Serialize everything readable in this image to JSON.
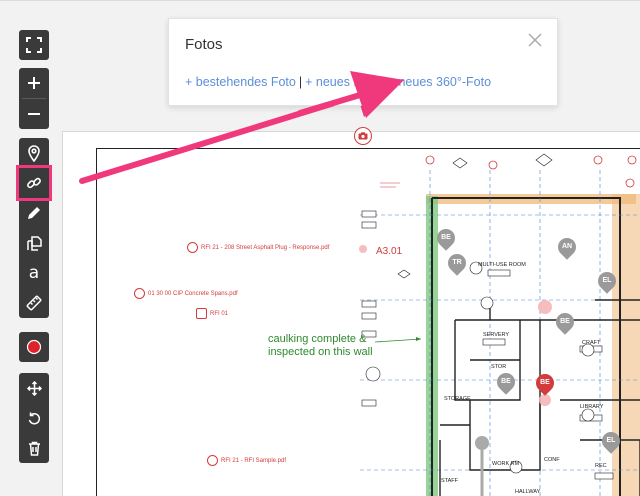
{
  "toolbar": {
    "buttons": [
      {
        "name": "fullscreen",
        "icon": "fullscreen-icon"
      },
      {
        "name": "zoom-in",
        "icon": "plus-icon"
      },
      {
        "name": "zoom-out",
        "icon": "minus-icon"
      },
      {
        "name": "pin",
        "icon": "map-pin-icon"
      },
      {
        "name": "link",
        "icon": "link-icon",
        "highlighted": true
      },
      {
        "name": "pen",
        "icon": "pen-icon"
      },
      {
        "name": "copy",
        "icon": "copy-icon"
      },
      {
        "name": "text",
        "icon": "text-icon",
        "label": "a"
      },
      {
        "name": "measure",
        "icon": "ruler-icon"
      },
      {
        "name": "record",
        "icon": "record-icon"
      },
      {
        "name": "move",
        "icon": "move-icon"
      },
      {
        "name": "undo",
        "icon": "undo-icon"
      },
      {
        "name": "delete",
        "icon": "trash-icon"
      }
    ],
    "highlight_color": "#f0387c",
    "background_color": "#3a3a3a"
  },
  "popup": {
    "title": "Fotos",
    "links": [
      {
        "label": "+ bestehendes Foto"
      },
      {
        "label": "+ neues Foto"
      },
      {
        "label": "+ neues 360°-Foto"
      }
    ],
    "separator": "|",
    "link_color": "#5b8fd8"
  },
  "plan": {
    "annotations": [
      {
        "text": "RFI 21 - 208 Street Asphalt Plug - Response.pdf"
      },
      {
        "text": "01 30 00 CIP Concrete Spans.pdf"
      },
      {
        "text": "RFI 01"
      },
      {
        "text": "RFI 21 - RFI Sample.pdf"
      }
    ],
    "green_note": [
      "caulking complete &",
      "inspected on this wall"
    ],
    "sheet_ref": "A3.01",
    "markers": [
      {
        "label": "BE",
        "color": "#9a9a9a"
      },
      {
        "label": "AN",
        "color": "#9a9a9a"
      },
      {
        "label": "TR",
        "color": "#9a9a9a"
      },
      {
        "label": "EL",
        "color": "#9a9a9a"
      },
      {
        "label": "BE",
        "color": "#9a9a9a"
      },
      {
        "label": "BE",
        "color": "#9a9a9a"
      },
      {
        "label": "BE",
        "color": "#d23c3c"
      },
      {
        "label": "EL",
        "color": "#9a9a9a"
      }
    ],
    "rooms": [
      "MULTI-USE ROOM",
      "SERVERY",
      "STOR",
      "STORAGE",
      "CRAFT",
      "LIBRARY",
      "WORK RM",
      "CONF",
      "STAFF",
      "REC",
      "HALLWAY"
    ],
    "accent_red": "#d23c3c",
    "wall_green": "#7ec87e",
    "wall_orange": "#f0b87a"
  }
}
